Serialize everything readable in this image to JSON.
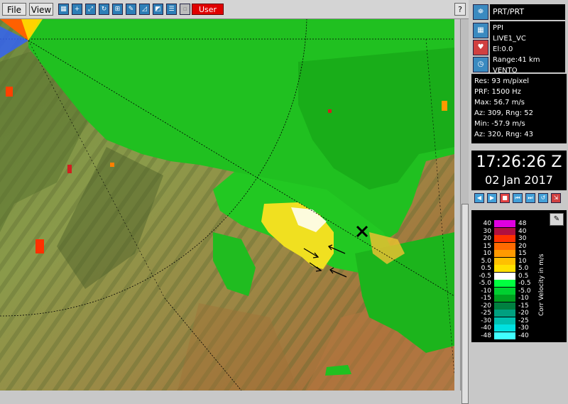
{
  "menu": {
    "file": "File",
    "view": "View",
    "user": "User",
    "help": "?"
  },
  "toolbar": [
    {
      "name": "layers-icon",
      "glyph": "▦"
    },
    {
      "name": "crosshair-icon",
      "glyph": "+"
    },
    {
      "name": "zoom-icon",
      "glyph": "⤢"
    },
    {
      "name": "rotate-icon",
      "glyph": "↻"
    },
    {
      "name": "grid-icon",
      "glyph": "⊞"
    },
    {
      "name": "draw-icon",
      "glyph": "✎"
    },
    {
      "name": "measure-icon",
      "glyph": "◿"
    },
    {
      "name": "annotate-icon",
      "glyph": "◩"
    },
    {
      "name": "list-icon",
      "glyph": "☰"
    },
    {
      "name": "disabled-icon",
      "glyph": "▫"
    }
  ],
  "panel": {
    "title": "PRT/PRT",
    "product": "PPI",
    "task": "LIVE1_VC",
    "elevation": "El:0.0",
    "range": "Range:41 km",
    "site": "VENTO",
    "stats": [
      "Res: 93 m/pixel",
      "PRF: 1500 Hz",
      "Max: 56.7 m/s",
      "Az:  309, Rng: 52",
      "Min: -57.9 m/s",
      "Az:  320, Rng: 43"
    ],
    "time": "17:26:26 Z",
    "date": "02 Jan 2017"
  },
  "legend": {
    "units": "Corr Velocity in m/s",
    "rows": [
      {
        "l": "40",
        "r": "48",
        "c": "#e000e0"
      },
      {
        "l": "30",
        "r": "40",
        "c": "#b01040"
      },
      {
        "l": "20",
        "r": "30",
        "c": "#ff3000"
      },
      {
        "l": "15",
        "r": "20",
        "c": "#ff6a00"
      },
      {
        "l": "10",
        "r": "15",
        "c": "#ff9a00"
      },
      {
        "l": "5.0",
        "r": "10",
        "c": "#ffc000"
      },
      {
        "l": "0.5",
        "r": "5.0",
        "c": "#ffe000"
      },
      {
        "l": "-0.5",
        "r": "0.5",
        "c": "#ffffff"
      },
      {
        "l": "-5.0",
        "r": "-0.5",
        "c": "#00ff40"
      },
      {
        "l": "-10",
        "r": "-5.0",
        "c": "#00d030"
      },
      {
        "l": "-15",
        "r": "-10",
        "c": "#00a020"
      },
      {
        "l": "-20",
        "r": "-15",
        "c": "#008040"
      },
      {
        "l": "-25",
        "r": "-20",
        "c": "#00a080"
      },
      {
        "l": "-30",
        "r": "-25",
        "c": "#00c0b0"
      },
      {
        "l": "-40",
        "r": "-30",
        "c": "#00e0e0"
      },
      {
        "l": "-48",
        "r": "-40",
        "c": "#40ffff"
      }
    ]
  },
  "colors": {
    "terrain_low": "#7f9a4a",
    "terrain_high": "#a86a3a",
    "echo_green": "#20c020",
    "echo_yellow": "#f0e020",
    "accent_red": "#e00000"
  }
}
